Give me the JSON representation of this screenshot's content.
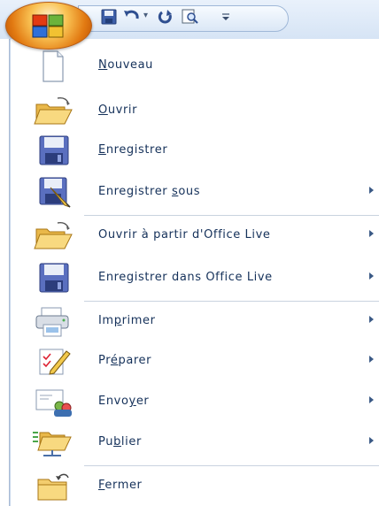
{
  "menu": {
    "items": [
      {
        "id": "nouveau",
        "pre": "",
        "acc": "N",
        "post": "ouveau",
        "submenu": false
      },
      {
        "id": "ouvrir",
        "pre": "",
        "acc": "O",
        "post": "uvrir",
        "submenu": false
      },
      {
        "id": "enregistrer",
        "pre": "",
        "acc": "E",
        "post": "nregistrer",
        "submenu": false
      },
      {
        "id": "enregistrer-sous",
        "pre": "Enregistrer ",
        "acc": "s",
        "post": "ous",
        "submenu": true
      },
      {
        "id": "ouvrir-office-live",
        "pre": "Ouvrir à partir d'Office Live",
        "acc": "",
        "post": "",
        "submenu": true
      },
      {
        "id": "enregistrer-office-live",
        "pre": "Enregistrer dans Office Live",
        "acc": "",
        "post": "",
        "submenu": true
      },
      {
        "id": "imprimer",
        "pre": "Im",
        "acc": "p",
        "post": "rimer",
        "submenu": true
      },
      {
        "id": "preparer",
        "pre": "Pr",
        "acc": "é",
        "post": "parer",
        "submenu": true
      },
      {
        "id": "envoyer",
        "pre": "Envo",
        "acc": "y",
        "post": "er",
        "submenu": true
      },
      {
        "id": "publier",
        "pre": "Pu",
        "acc": "b",
        "post": "lier",
        "submenu": true
      },
      {
        "id": "fermer",
        "pre": "",
        "acc": "F",
        "post": "ermer",
        "submenu": false
      }
    ]
  },
  "colors": {
    "text": "#15315a",
    "accent": "#e27a12",
    "separator": "#c9d3df"
  }
}
